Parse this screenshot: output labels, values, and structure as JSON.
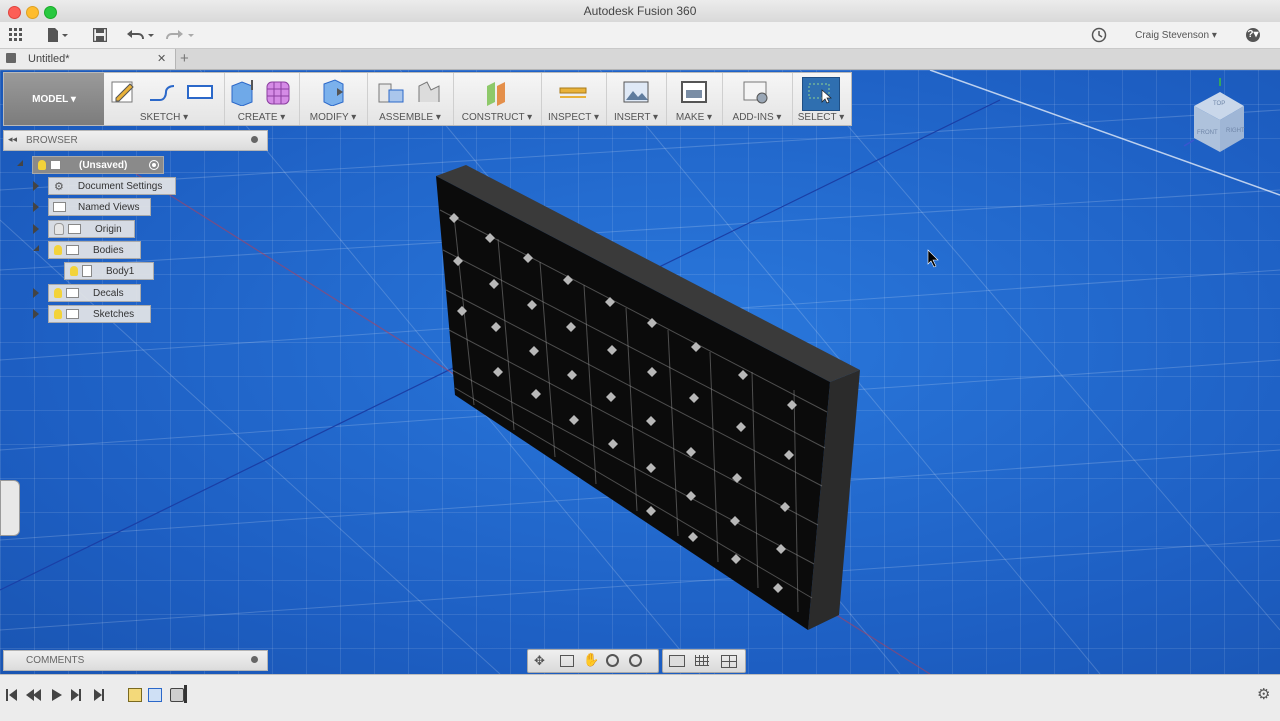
{
  "window": {
    "title": "Autodesk Fusion 360"
  },
  "appbar": {
    "user": "Craig Stevenson ▾",
    "help": "?▾"
  },
  "tabs": [
    {
      "label": "Untitled*",
      "close": "✕"
    }
  ],
  "tab_add": "+",
  "toolbar": {
    "workspace": "MODEL ▾",
    "groups": [
      "SKETCH ▾",
      "CREATE ▾",
      "MODIFY ▾",
      "ASSEMBLE ▾",
      "CONSTRUCT ▾",
      "INSPECT ▾",
      "INSERT ▾",
      "MAKE ▾",
      "ADD-INS ▾",
      "SELECT ▾"
    ]
  },
  "browser": {
    "title": "BROWSER",
    "root": "(Unsaved)",
    "items": [
      {
        "label": "Document Settings"
      },
      {
        "label": "Named Views"
      },
      {
        "label": "Origin"
      },
      {
        "label": "Bodies"
      },
      {
        "label": "Body1"
      },
      {
        "label": "Decals"
      },
      {
        "label": "Sketches"
      }
    ]
  },
  "comments": {
    "title": "COMMENTS"
  },
  "viewcube": {
    "front": "FRONT",
    "right": "RIGHT",
    "top": "TOP"
  },
  "colors": {
    "viewport": "#1e63c8",
    "accent": "#2f6fb0",
    "bulb": "#f3d33a"
  }
}
